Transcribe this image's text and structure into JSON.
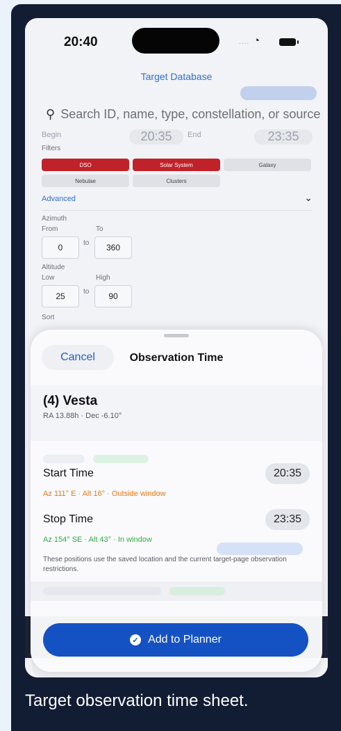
{
  "caption": "Target observation time sheet.",
  "status_bar": {
    "time": "20:40",
    "signal": "....",
    "wifi_icon": "wifi-icon",
    "battery_icon": "battery-icon"
  },
  "background": {
    "title": "Target Database",
    "search_placeholder": "Search ID, name, type, constellation, or source",
    "begin_label": "Begin",
    "begin_time": "20:35",
    "end_label": "End",
    "end_time": "23:35",
    "filters_label": "Filters",
    "filters": [
      {
        "label": "DSO",
        "active": true
      },
      {
        "label": "Solar System",
        "active": true
      },
      {
        "label": "Galaxy",
        "active": false
      },
      {
        "label": "Nebulae",
        "active": false
      },
      {
        "label": "Clusters",
        "active": false
      }
    ],
    "advanced_label": "Advanced",
    "azimuth_label": "Azimuth",
    "from_label": "From",
    "to_label": "To",
    "azimuth_from": "0",
    "azimuth_to": "360",
    "range_separator": "to",
    "altitude_label": "Altitude",
    "low_label": "Low",
    "high_label": "High",
    "altitude_low": "25",
    "altitude_high": "90",
    "sort_label": "Sort"
  },
  "sheet": {
    "cancel_label": "Cancel",
    "title": "Observation Time",
    "target_name": "(4) Vesta",
    "target_coords": "RA 13.88h · Dec -6.10°",
    "start_label": "Start Time",
    "start_time": "20:35",
    "start_status": "Az 111° E · Alt 16° · Outside window",
    "stop_label": "Stop Time",
    "stop_time": "23:35",
    "stop_status": "Az 154° SE · Alt 43° · In window",
    "note": "These positions use the saved location and the current target-page observation restrictions.",
    "add_label": "Add to Planner"
  },
  "colors": {
    "accent": "#1452c4",
    "active_chip": "#c0222a",
    "outside_window": "#e07a1a",
    "in_window": "#2fae42"
  }
}
